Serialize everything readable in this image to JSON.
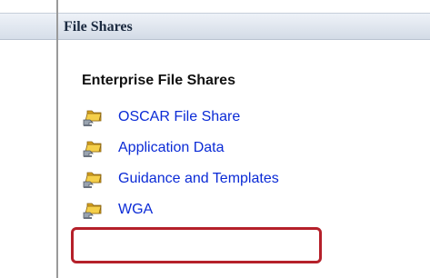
{
  "panel": {
    "title": "File Shares"
  },
  "section": {
    "title": "Enterprise File Shares"
  },
  "shares": [
    {
      "label": "OSCAR File Share",
      "icon": "folder-share-icon"
    },
    {
      "label": "Application Data",
      "icon": "folder-share-icon"
    },
    {
      "label": "Guidance and Templates",
      "icon": "folder-share-icon"
    },
    {
      "label": "WGA",
      "icon": "folder-share-icon",
      "highlighted": true
    }
  ],
  "colors": {
    "link": "#0b2bd6",
    "highlight": "#b5202a",
    "header_text": "#1b2a40"
  }
}
